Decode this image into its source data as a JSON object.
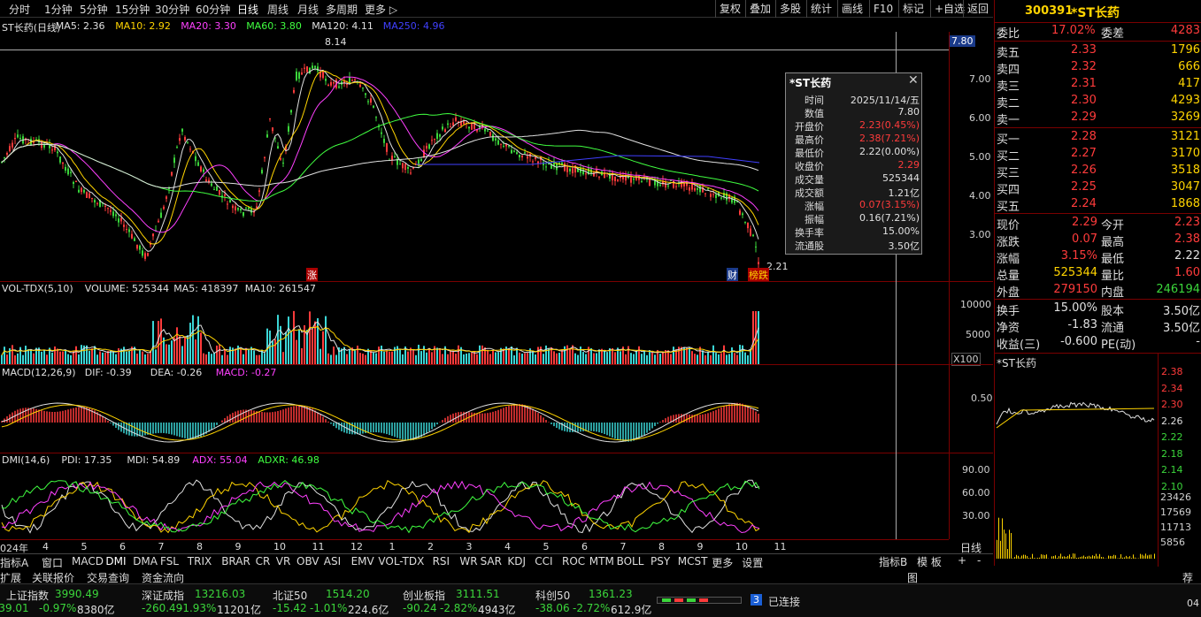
{
  "toolbar": {
    "periods": [
      "分时",
      "1分钟",
      "5分钟",
      "15分钟",
      "30分钟",
      "60分钟",
      "日线",
      "周线",
      "月线",
      "多周期",
      "更多 ▷"
    ],
    "active_period": "日线",
    "buttons": [
      "复权",
      "叠加",
      "多股",
      "统计",
      "画线",
      "F10",
      "标记",
      "+自选",
      "返回"
    ]
  },
  "main_chart": {
    "legend": [
      {
        "text": "ST长药(日线)",
        "color": "#e0e0e0"
      },
      {
        "text": "MA5: 2.36",
        "color": "#e0e0e0"
      },
      {
        "text": "MA10: 2.92",
        "color": "#ffd400"
      },
      {
        "text": "MA20: 3.30",
        "color": "#ff40ff"
      },
      {
        "text": "MA60: 3.80",
        "color": "#40ff40"
      },
      {
        "text": "MA120: 4.11",
        "color": "#e0e0e0"
      },
      {
        "text": "MA250: 4.96",
        "color": "#4040ff"
      }
    ],
    "price_axis": [
      "7.00",
      "6.00",
      "5.00",
      "4.00",
      "3.00"
    ],
    "crosshair_value": "7.80",
    "high_mark": "8.14",
    "low_mark": "2.21",
    "markers": {
      "zhang": "涨",
      "cai": "财",
      "bang": "榜跌"
    }
  },
  "volume_chart": {
    "legend": [
      {
        "text": "VOL-TDX(5,10)",
        "color": "#e0e0e0"
      },
      {
        "text": "VOLUME: 525344",
        "color": "#e0e0e0"
      },
      {
        "text": "MA5: 418397",
        "color": "#e0e0e0"
      },
      {
        "text": "MA10: 261547",
        "color": "#e0e0e0"
      }
    ],
    "axis": [
      "10000",
      "5000"
    ],
    "unit": "X100"
  },
  "macd_chart": {
    "legend": [
      {
        "text": "MACD(12,26,9)",
        "color": "#e0e0e0"
      },
      {
        "text": "DIF: -0.39",
        "color": "#e0e0e0"
      },
      {
        "text": "DEA: -0.26",
        "color": "#e0e0e0"
      },
      {
        "text": "MACD: -0.27",
        "color": "#ff40ff"
      }
    ],
    "axis": [
      "0.50"
    ]
  },
  "dmi_chart": {
    "legend": [
      {
        "text": "DMI(14,6)",
        "color": "#e0e0e0"
      },
      {
        "text": "PDI: 17.35",
        "color": "#e0e0e0"
      },
      {
        "text": "MDI: 54.89",
        "color": "#e0e0e0"
      },
      {
        "text": "ADX: 55.04",
        "color": "#ff40ff"
      },
      {
        "text": "ADXR: 46.98",
        "color": "#40ff40"
      }
    ],
    "axis": [
      "90.00",
      "60.00",
      "30.00"
    ]
  },
  "date_axis": [
    "024年",
    "4",
    "5",
    "6",
    "7",
    "8",
    "9",
    "10",
    "11",
    "12",
    "1",
    "2",
    "3",
    "4",
    "5",
    "6",
    "7",
    "8",
    "9",
    "10",
    "11"
  ],
  "period_label": "日线",
  "indicator_tabs": [
    "指标A",
    "窗口",
    "MACD",
    "DMI",
    "DMA",
    "FSL",
    "TRIX",
    "BRAR",
    "CR",
    "VR",
    "OBV",
    "ASI",
    "EMV",
    "VOL-TDX",
    "RSI",
    "WR",
    "SAR",
    "KDJ",
    "CCI",
    "ROC",
    "MTM",
    "BOLL",
    "PSY",
    "MCST",
    "更多",
    "设置"
  ],
  "indicator_right": [
    "指标B",
    "模 板",
    "+",
    "-"
  ],
  "sub_tabs": [
    "扩展",
    "关联报价",
    "交易查询",
    "资金流向"
  ],
  "popup": {
    "title": "*ST长药",
    "rows": [
      {
        "label": "时间",
        "value": "2025/11/14/五",
        "color": "#e0e0e0"
      },
      {
        "label": "数值",
        "value": "7.80",
        "color": "#e0e0e0"
      },
      {
        "label": "开盘价",
        "value": "2.23(0.45%)",
        "color": "#ff3b3b"
      },
      {
        "label": "最高价",
        "value": "2.38(7.21%)",
        "color": "#ff3b3b"
      },
      {
        "label": "最低价",
        "value": "2.22(0.00%)",
        "color": "#e0e0e0"
      },
      {
        "label": "收盘价",
        "value": "2.29",
        "color": "#ff3b3b"
      },
      {
        "label": "成交量",
        "value": "525344",
        "color": "#e0e0e0"
      },
      {
        "label": "成交额",
        "value": "1.21亿",
        "color": "#e0e0e0"
      },
      {
        "label": "涨幅",
        "value": "0.07(3.15%)",
        "color": "#ff3b3b"
      },
      {
        "label": "振幅",
        "value": "0.16(7.21%)",
        "color": "#e0e0e0"
      },
      {
        "label": "换手率",
        "value": "15.00%",
        "color": "#e0e0e0"
      },
      {
        "label": "流通股",
        "value": "3.50亿",
        "color": "#e0e0e0"
      }
    ]
  },
  "quote": {
    "code": "300391",
    "name": "*ST长药",
    "weibi_label": "委比",
    "weibi": "17.02%",
    "weicha_label": "委差",
    "weicha": "4283",
    "sells": [
      {
        "label": "卖五",
        "price": "2.33",
        "vol": "1796"
      },
      {
        "label": "卖四",
        "price": "2.32",
        "vol": "666"
      },
      {
        "label": "卖三",
        "price": "2.31",
        "vol": "417"
      },
      {
        "label": "卖二",
        "price": "2.30",
        "vol": "4293"
      },
      {
        "label": "卖一",
        "price": "2.29",
        "vol": "3269"
      }
    ],
    "buys": [
      {
        "label": "买一",
        "price": "2.28",
        "vol": "3121"
      },
      {
        "label": "买二",
        "price": "2.27",
        "vol": "3170"
      },
      {
        "label": "买三",
        "price": "2.26",
        "vol": "3518"
      },
      {
        "label": "买四",
        "price": "2.25",
        "vol": "3047"
      },
      {
        "label": "买五",
        "price": "2.24",
        "vol": "1868"
      }
    ],
    "stats": [
      {
        "l1": "现价",
        "v1": "2.29",
        "c1": "#ff3b3b",
        "l2": "今开",
        "v2": "2.23",
        "c2": "#ff3b3b"
      },
      {
        "l1": "涨跌",
        "v1": "0.07",
        "c1": "#ff3b3b",
        "l2": "最高",
        "v2": "2.38",
        "c2": "#ff3b3b"
      },
      {
        "l1": "涨幅",
        "v1": "3.15%",
        "c1": "#ff3b3b",
        "l2": "最低",
        "v2": "2.22",
        "c2": "#e0e0e0"
      },
      {
        "l1": "总量",
        "v1": "525344",
        "c1": "#ffd400",
        "l2": "量比",
        "v2": "1.60",
        "c2": "#ff3b3b"
      },
      {
        "l1": "外盘",
        "v1": "279150",
        "c1": "#ff3b3b",
        "l2": "内盘",
        "v2": "246194",
        "c2": "#3bd63b"
      }
    ],
    "stats2": [
      {
        "l1": "换手",
        "v1": "15.00%",
        "c1": "#e0e0e0",
        "l2": "股本",
        "v2": "3.50亿",
        "c2": "#e0e0e0"
      },
      {
        "l1": "净资",
        "v1": "-1.83",
        "c1": "#e0e0e0",
        "l2": "流通",
        "v2": "3.50亿",
        "c2": "#e0e0e0"
      },
      {
        "l1": "收益(三)",
        "v1": "-0.600",
        "c1": "#e0e0e0",
        "l2": "PE(动)",
        "v2": "-",
        "c2": "#e0e0e0"
      }
    ],
    "mini_title": "*ST长药",
    "mini_axis": [
      "2.38",
      "2.34",
      "2.30",
      "2.26",
      "2.22",
      "2.18",
      "2.14",
      "2.10"
    ],
    "mini_vol_axis": [
      "23426",
      "17569",
      "11713",
      "5856"
    ]
  },
  "ticker": [
    {
      "name": "上证指数",
      "value": "3990.49",
      "chg": "-39.01",
      "pct": "-0.97%",
      "amt": "8380亿"
    },
    {
      "name": "深证成指",
      "value": "13216.03",
      "chg": "-260.49",
      "pct": "-1.93%",
      "amt": "11201亿"
    },
    {
      "name": "北证50",
      "value": "1514.20",
      "chg": "-15.42",
      "pct": "-1.01%",
      "amt": "224.6亿"
    },
    {
      "name": "创业板指",
      "value": "3111.51",
      "chg": "-90.24",
      "pct": "-2.82%",
      "amt": "4943亿"
    },
    {
      "name": "科创50",
      "value": "1361.23",
      "chg": "-38.06",
      "pct": "-2.72%",
      "amt": "612.9亿"
    }
  ],
  "connection": {
    "count": "3",
    "status": "已连接"
  },
  "footer_right": [
    "图",
    "荐",
    "04"
  ]
}
